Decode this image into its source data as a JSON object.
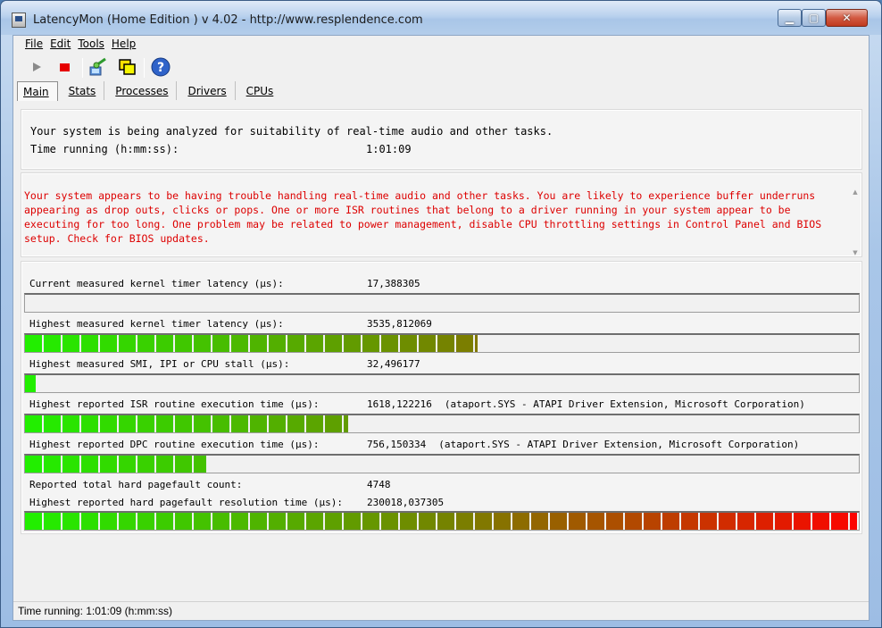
{
  "window": {
    "title": "LatencyMon  (Home Edition )  v 4.02 - http://www.resplendence.com",
    "minimize": "▁",
    "maximize": "▢",
    "close": "✕"
  },
  "menu": [
    "File",
    "Edit",
    "Tools",
    "Help"
  ],
  "toolbar": {
    "icons": [
      "play-icon",
      "stop-icon",
      "analyze-icon",
      "windows-icon",
      "help-icon"
    ]
  },
  "tabs": [
    {
      "label": "Main",
      "active": true
    },
    {
      "label": "Stats",
      "active": false
    },
    {
      "label": "Processes",
      "active": false
    },
    {
      "label": "Drivers",
      "active": false
    },
    {
      "label": "CPUs",
      "active": false
    }
  ],
  "summary": {
    "line1": "Your system is being analyzed for suitability of real-time audio and other tasks.",
    "time_label": "Time running (h:mm:ss):",
    "time_value": "1:01:09"
  },
  "warning": "Your system appears to be having trouble handling real-time audio and other tasks. You are likely to experience buffer underruns appearing as drop outs, clicks or pops. One or more ISR routines that belong to a driver running in your system appear to be executing for too long. One problem may be related to power management, disable CPU throttling settings in Control Panel and BIOS setup. Check for BIOS updates.",
  "metrics": [
    {
      "label": "Current measured kernel timer latency (µs):",
      "value": "17,388305",
      "detail": "",
      "bar_fraction": 0.0
    },
    {
      "label": "Highest measured kernel timer latency (µs):",
      "value": "3535,812069",
      "detail": "",
      "bar_fraction": 0.545
    },
    {
      "label": "Highest measured SMI, IPI or CPU stall (µs):",
      "value": "32,496177",
      "detail": "",
      "bar_fraction": 0.015
    },
    {
      "label": "Highest reported ISR routine execution time (µs):",
      "value": "1618,122216",
      "detail": "(ataport.SYS - ATAPI Driver Extension, Microsoft Corporation)",
      "bar_fraction": 0.39
    },
    {
      "label": "Highest reported DPC routine execution time (µs):",
      "value": "756,150334",
      "detail": "(ataport.SYS - ATAPI Driver Extension, Microsoft Corporation)",
      "bar_fraction": 0.22
    }
  ],
  "pagefault": {
    "count_label": "Reported total hard pagefault count:",
    "count_value": "4748",
    "resolution_label": "Highest reported hard pagefault resolution time (µs):",
    "resolution_value": "230018,037305",
    "bar_fraction": 1.0
  },
  "status": "Time running: 1:01:09  (h:mm:ss)",
  "colors": {
    "bar_start": "#22ee00",
    "bar_end": "#ff0000",
    "warning_text": "#dd0000"
  }
}
